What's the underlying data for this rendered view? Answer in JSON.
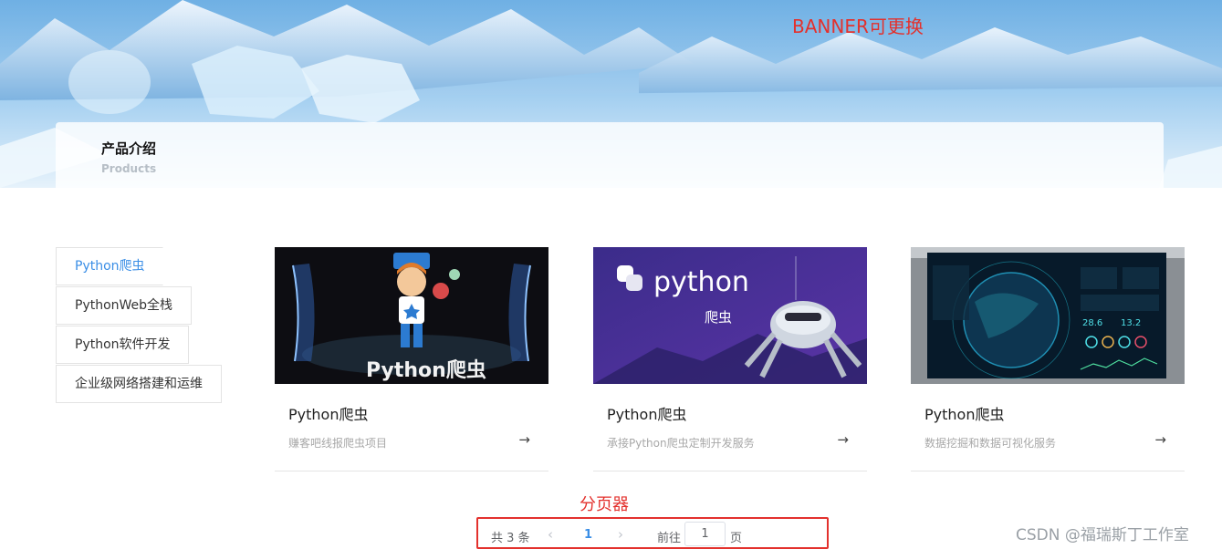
{
  "banner": {
    "note": "BANNER可更换",
    "title_cn": "产品介绍",
    "title_en": "Products"
  },
  "sidebar": {
    "items": [
      {
        "label": "Python爬虫",
        "active": true
      },
      {
        "label": "PythonWeb全栈",
        "active": false
      },
      {
        "label": "Python软件开发",
        "active": false
      },
      {
        "label": "企业级网络搭建和运维",
        "active": false
      }
    ]
  },
  "cards": [
    {
      "image_text": "Python爬虫",
      "title": "Python爬虫",
      "desc": "赚客吧线报爬虫项目"
    },
    {
      "image_text": "python",
      "image_subtext": "爬虫",
      "title": "Python爬虫",
      "desc": "承接Python爬虫定制开发服务"
    },
    {
      "title": "Python爬虫",
      "desc": "数据挖掘和数据可视化服务",
      "dash_values": [
        "28.6",
        "13.2"
      ]
    }
  ],
  "pagination": {
    "note": "分页器",
    "total": "共 3 条",
    "current": "1",
    "goto_label": "前往",
    "goto_value": "1",
    "page_label": "页"
  },
  "watermark": "CSDN @福瑞斯丁工作室",
  "colors": {
    "accent": "#3a8ee6",
    "annotation": "#e3312d"
  }
}
